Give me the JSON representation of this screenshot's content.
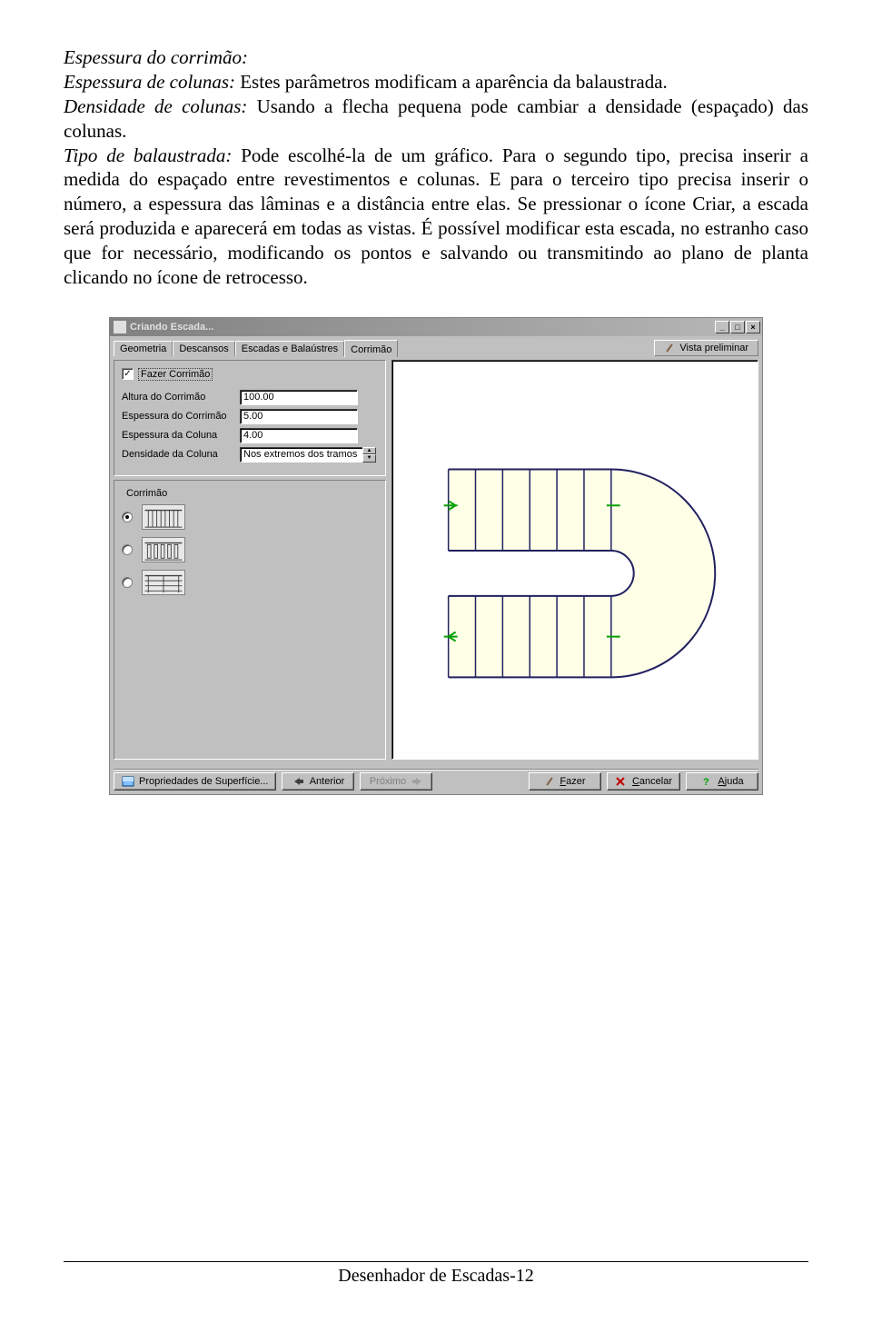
{
  "paragraph": {
    "s1_label": "Espessura do corrimão:",
    "s2_label": "Espessura de colunas:",
    "s2_text": "  Estes parâmetros modificam a aparência da balaustrada.",
    "s3_label": "Densidade de colunas:",
    "s3_text": "  Usando a flecha pequena pode cambiar a densidade (espaçado) das colunas.",
    "s4_label": "Tipo de balaustrada:",
    "s4_text": "  Pode escolhé-la de um gráfico. Para o segundo tipo, precisa inserir a medida do espaçado entre revestimentos e colunas.  E para o terceiro tipo precisa inserir o número, a espessura das lâminas e a distância entre elas. Se pressionar o ícone Criar, a escada será produzida e aparecerá em todas as vistas.  É possível modificar esta escada, no estranho caso que for necessário, modificando os pontos e salvando ou transmitindo ao plano de planta clicando no ícone de retrocesso."
  },
  "dialog": {
    "title": "Criando Escada...",
    "tabs": [
      "Geometria",
      "Descansos",
      "Escadas e Balaústres",
      "Corrimão"
    ],
    "active_tab": 3,
    "vista_btn": "Vista preliminar",
    "checkbox_label": "Fazer Corrimão",
    "checkbox_checked": true,
    "fields": [
      {
        "label": "Altura do Corrimão",
        "value": "100.00"
      },
      {
        "label": "Espessura do Corrimão",
        "value": "5.00"
      },
      {
        "label": "Espessura da Coluna",
        "value": "4.00"
      }
    ],
    "combo": {
      "label": "Densidade da Coluna",
      "value": "Nos extremos dos tramos"
    },
    "group_title": "Corrimão",
    "buttons": {
      "propriedades": "Propriedades de Superfície...",
      "anterior": "Anterior",
      "proximo": "Próximo",
      "fazer": "Fazer",
      "cancelar": "Cancelar",
      "ajuda": "Ajuda"
    }
  },
  "footer": "Desenhador de Escadas-12"
}
